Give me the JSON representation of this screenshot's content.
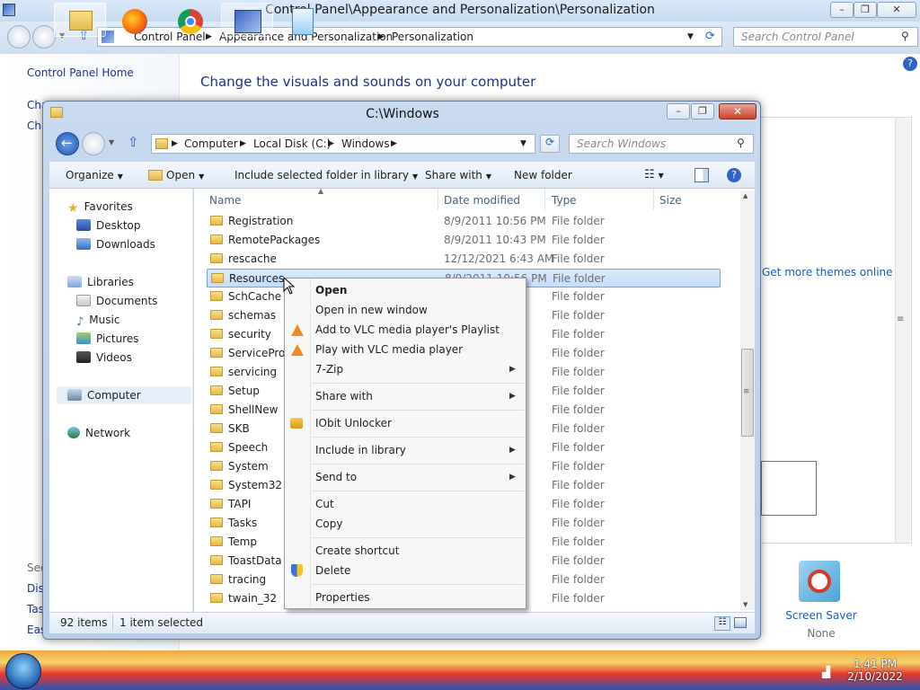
{
  "control_panel": {
    "title": "Control Panel\\Appearance and Personalization\\Personalization",
    "breadcrumbs": [
      "Control Panel",
      "Appearance and Personalization",
      "Personalization"
    ],
    "search_placeholder": "Search Control Panel",
    "home_link": "Control Panel Home",
    "left_links": [
      "Cha",
      "Cha"
    ],
    "see_also": [
      "See",
      "Disp",
      "Tas",
      "Eas"
    ],
    "headline": "Change the visuals and sounds on your computer",
    "themes_link": "Get more themes online",
    "screen_saver": {
      "label": "Screen Saver",
      "value": "None"
    }
  },
  "explorer": {
    "title": "C:\\Windows",
    "breadcrumbs": [
      "Computer",
      "Local Disk (C:)",
      "Windows"
    ],
    "search_placeholder": "Search Windows",
    "toolbar": {
      "organize": "Organize",
      "open": "Open",
      "include": "Include selected folder in library",
      "share": "Share with",
      "new_folder": "New folder"
    },
    "nav": {
      "favorites": "Favorites",
      "desktop": "Desktop",
      "downloads": "Downloads",
      "libraries": "Libraries",
      "documents": "Documents",
      "music": "Music",
      "pictures": "Pictures",
      "videos": "Videos",
      "computer": "Computer",
      "network": "Network"
    },
    "columns": {
      "name": "Name",
      "date": "Date modified",
      "type": "Type",
      "size": "Size"
    },
    "rows": [
      {
        "name": "Registration",
        "date": "8/9/2011 10:56 PM",
        "type": "File folder"
      },
      {
        "name": "RemotePackages",
        "date": "8/9/2011 10:43 PM",
        "type": "File folder"
      },
      {
        "name": "rescache",
        "date": "12/12/2021 6:43 AM",
        "type": "File folder"
      },
      {
        "name": "Resources",
        "date": "8/9/2011 10:56 PM",
        "type": "File folder"
      },
      {
        "name": "SchCache",
        "date": "",
        "type": "File folder"
      },
      {
        "name": "schemas",
        "date": "",
        "type": "File folder"
      },
      {
        "name": "security",
        "date": "",
        "type": "File folder"
      },
      {
        "name": "ServiceProfi",
        "date": "",
        "type": "File folder"
      },
      {
        "name": "servicing",
        "date": "",
        "type": "File folder"
      },
      {
        "name": "Setup",
        "date": "",
        "type": "File folder"
      },
      {
        "name": "ShellNew",
        "date": "",
        "type": "File folder"
      },
      {
        "name": "SKB",
        "date": "",
        "type": "File folder"
      },
      {
        "name": "Speech",
        "date": "",
        "type": "File folder"
      },
      {
        "name": "System",
        "date": "",
        "type": "File folder"
      },
      {
        "name": "System32",
        "date": "",
        "type": "File folder"
      },
      {
        "name": "TAPI",
        "date": "",
        "type": "File folder"
      },
      {
        "name": "Tasks",
        "date": "",
        "type": "File folder"
      },
      {
        "name": "Temp",
        "date": "",
        "type": "File folder"
      },
      {
        "name": "ToastData",
        "date": "",
        "type": "File folder"
      },
      {
        "name": "tracing",
        "date": "",
        "type": "File folder"
      },
      {
        "name": "twain_32",
        "date": "",
        "type": "File folder"
      }
    ],
    "status": {
      "count": "92 items",
      "selected": "1 item selected"
    }
  },
  "context_menu": {
    "open": "Open",
    "open_new_window": "Open in new window",
    "vlc_add": "Add to VLC media player's Playlist",
    "vlc_play": "Play with VLC media player",
    "zip": "7-Zip",
    "share_with": "Share with",
    "iobit": "IObit Unlocker",
    "include_library": "Include in library",
    "send_to": "Send to",
    "cut": "Cut",
    "copy": "Copy",
    "create_shortcut": "Create shortcut",
    "delete": "Delete",
    "properties": "Properties"
  },
  "taskbar": {
    "time": "1:41 PM",
    "date": "2/10/2022"
  },
  "colors": {
    "accent": "#1e3287",
    "selection": "#cde2fb"
  }
}
